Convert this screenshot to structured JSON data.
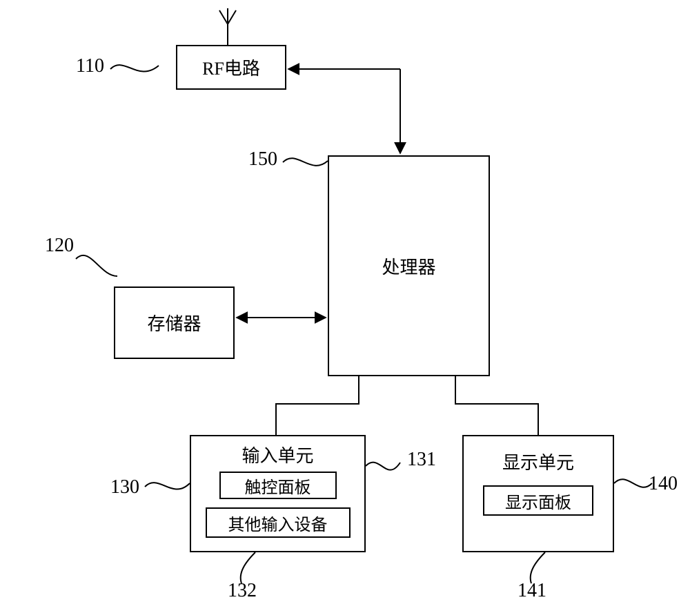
{
  "blocks": {
    "rf": {
      "ref": "110",
      "label": "RF电路"
    },
    "mem": {
      "ref": "120",
      "label": "存储器"
    },
    "input": {
      "ref": "130",
      "label": "输入单元",
      "touch": {
        "ref": "131",
        "label": "触控面板"
      },
      "other": {
        "ref": "132",
        "label": "其他输入设备"
      }
    },
    "display": {
      "ref": "140",
      "label": "显示单元",
      "panel": {
        "ref": "141",
        "label": "显示面板"
      }
    },
    "proc": {
      "ref": "150",
      "label": "处理器"
    }
  }
}
